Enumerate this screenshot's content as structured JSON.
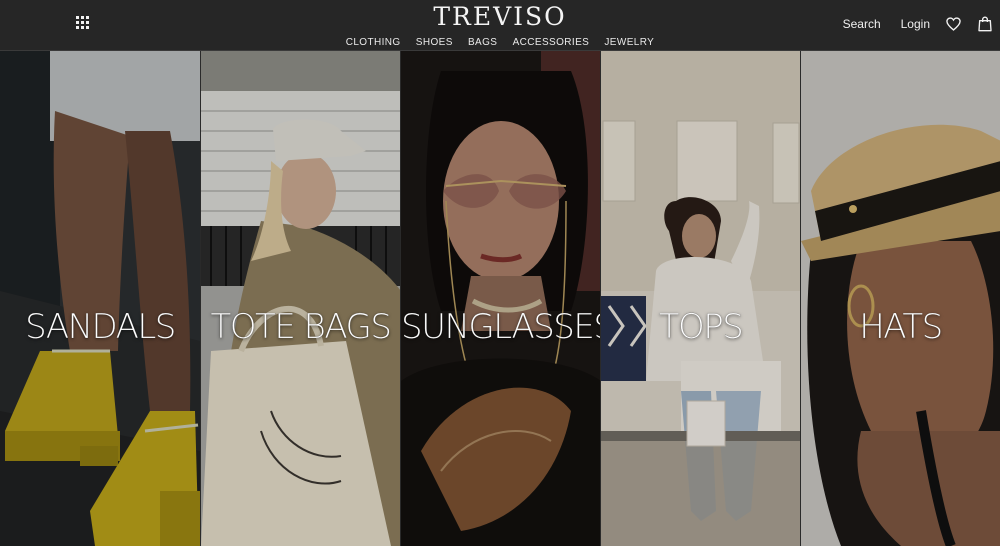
{
  "header": {
    "brand": "TREVISO",
    "nav": [
      "CLOTHING",
      "SHOES",
      "BAGS",
      "ACCESSORIES",
      "JEWELRY"
    ],
    "search_label": "Search",
    "login_label": "Login",
    "icons": [
      "grid-menu-icon",
      "heart-icon",
      "shopping-bag-icon"
    ]
  },
  "categories": [
    {
      "label": "SANDALS"
    },
    {
      "label": "TOTE BAGS"
    },
    {
      "label": "SUNGLASSES"
    },
    {
      "label": "TOPS"
    },
    {
      "label": "HATS"
    }
  ],
  "colors": {
    "header_bg": "#262626",
    "text": "#ffffff"
  }
}
